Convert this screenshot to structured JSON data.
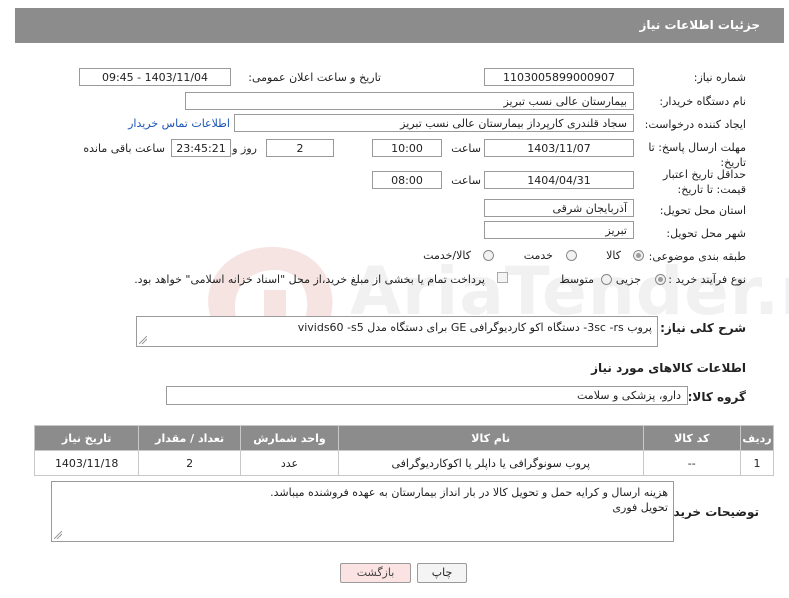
{
  "header": {
    "title": "جزئیات اطلاعات نیاز"
  },
  "fields": {
    "need_number_label": "شماره نیاز:",
    "need_number": "1103005899000907",
    "announce_label": "تاریخ و ساعت اعلان عمومی:",
    "announce_value": "1403/11/04 - 09:45",
    "buyer_org_label": "نام دستگاه خریدار:",
    "buyer_org": "بیمارستان عالی نسب تبریز",
    "creator_label": "ایجاد کننده درخواست:",
    "creator": "سجاد قلندری کارپرداز بیمارستان عالی نسب تبریز",
    "contact_link": "اطلاعات تماس خریدار",
    "reply_deadline_label": "مهلت ارسال پاسخ: تا تاریخ:",
    "reply_date": "1403/11/07",
    "time_label": "ساعت",
    "reply_time": "10:00",
    "days_value": "2",
    "days_and_label": "روز و",
    "remaining_time": "23:45:21",
    "remaining_label": "ساعت باقی مانده",
    "price_validity_label": "حداقل تاریخ اعتبار قیمت: تا تاریخ:",
    "price_date": "1404/04/31",
    "price_time": "08:00",
    "province_label": "استان محل تحویل:",
    "province": "آذربایجان شرقی",
    "city_label": "شهر محل تحویل:",
    "city": "تبریز",
    "category_label": "طبقه بندی موضوعی:",
    "category_options": [
      "کالا",
      "خدمت",
      "کالا/خدمت"
    ],
    "category_selected": "کالا",
    "process_label": "نوع فرآیند خرید :",
    "process_options": [
      "جزیی",
      "متوسط"
    ],
    "process_selected": "جزیی",
    "treasury_note": "پرداخت تمام یا بخشی از مبلغ خرید،از محل \"اسناد خزانه اسلامی\" خواهد بود."
  },
  "description": {
    "label": "شرح کلی نیاز:",
    "text": "پروب  3sc -rs- دستگاه اکو کاردیوگرافی GE   برای دستگاه مدل vivids60 -s5"
  },
  "goods_info": {
    "title": "اطلاعات کالاهای مورد نیاز",
    "group_label": "گروه کالا:",
    "group_value": "دارو، پزشکی و سلامت",
    "table": {
      "headers": [
        "ردیف",
        "کد کالا",
        "نام کالا",
        "واحد شمارش",
        "تعداد / مقدار",
        "تاریخ نیاز"
      ],
      "rows": [
        [
          "1",
          "--",
          "پروب سونوگرافی یا داپلر یا اکوکاردیوگرافی",
          "عدد",
          "2",
          "1403/11/18"
        ]
      ]
    }
  },
  "buyer_notes": {
    "label": "توضیحات خریدار:",
    "line1": "هزینه ارسال و کرایه حمل و تحویل کالا در بار انداز بیمارستان به عهده فروشنده میباشد.",
    "line2": "تحویل فوری"
  },
  "buttons": {
    "print": "چاپ",
    "back": "بازگشت"
  },
  "watermark": {
    "text": "AriaTender.neT"
  }
}
